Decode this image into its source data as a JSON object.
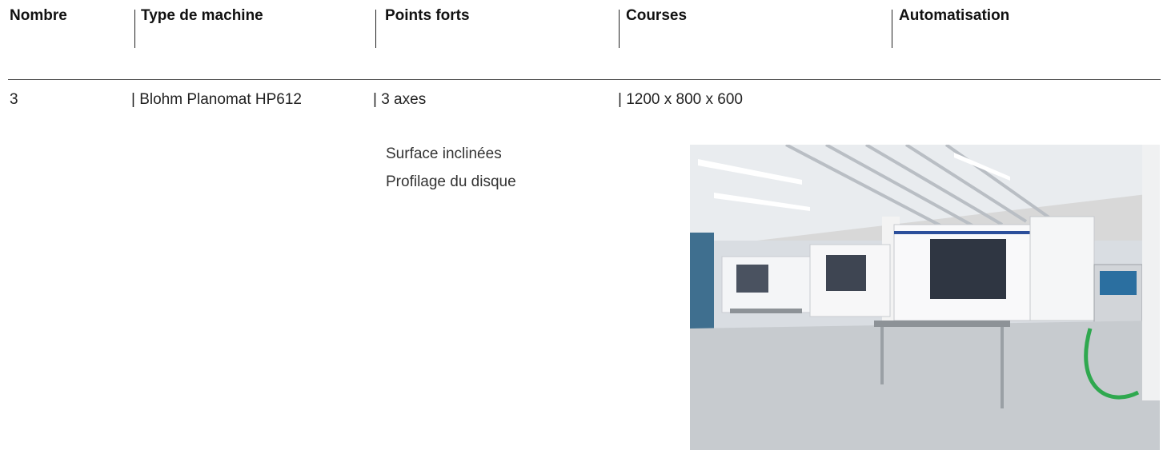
{
  "table": {
    "headers": [
      "Nombre",
      "Type de machine",
      "Points forts",
      "Courses",
      "Automatisation"
    ],
    "row": {
      "nombre": "3",
      "type": "| Blohm Planomat HP612",
      "points": "| 3 axes",
      "courses": "| 1200 x 800 x 600"
    }
  },
  "points_forts_extra": [
    "Surface inclinées",
    "Profilage du disque"
  ]
}
